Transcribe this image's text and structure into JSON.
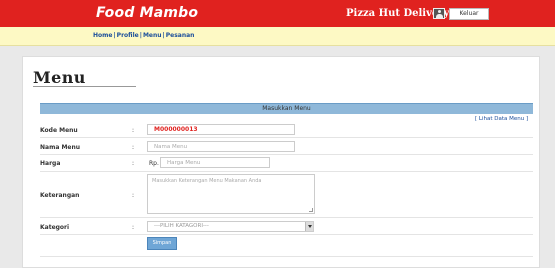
{
  "header": {
    "brand": "Food Mambo",
    "store_name": "Pizza Hut Delivery",
    "logout_label": "Keluar"
  },
  "nav": {
    "items": [
      {
        "label": "Home"
      },
      {
        "label": "Profile"
      },
      {
        "label": "Menu"
      },
      {
        "label": "Pesanan"
      }
    ],
    "separator": "|"
  },
  "page": {
    "title": "Menu",
    "form_header": "Masukkan Menu",
    "list_link": "[ Lihat Data Menu ]"
  },
  "form": {
    "colon": ":",
    "fields": {
      "kode": {
        "label": "Kode Menu",
        "value": "M000000013"
      },
      "nama": {
        "label": "Nama Menu",
        "placeholder": "Nama Menu"
      },
      "harga": {
        "label": "Harga",
        "currency": "Rp.",
        "placeholder": "Harga Menu"
      },
      "keterangan": {
        "label": "Keterangan",
        "placeholder": "Masukkan Keterangan Menu Makanan Anda"
      },
      "kategori": {
        "label": "Kategori",
        "selected": "---PILIH KATAGORI---"
      }
    },
    "submit_label": "Simpan"
  }
}
